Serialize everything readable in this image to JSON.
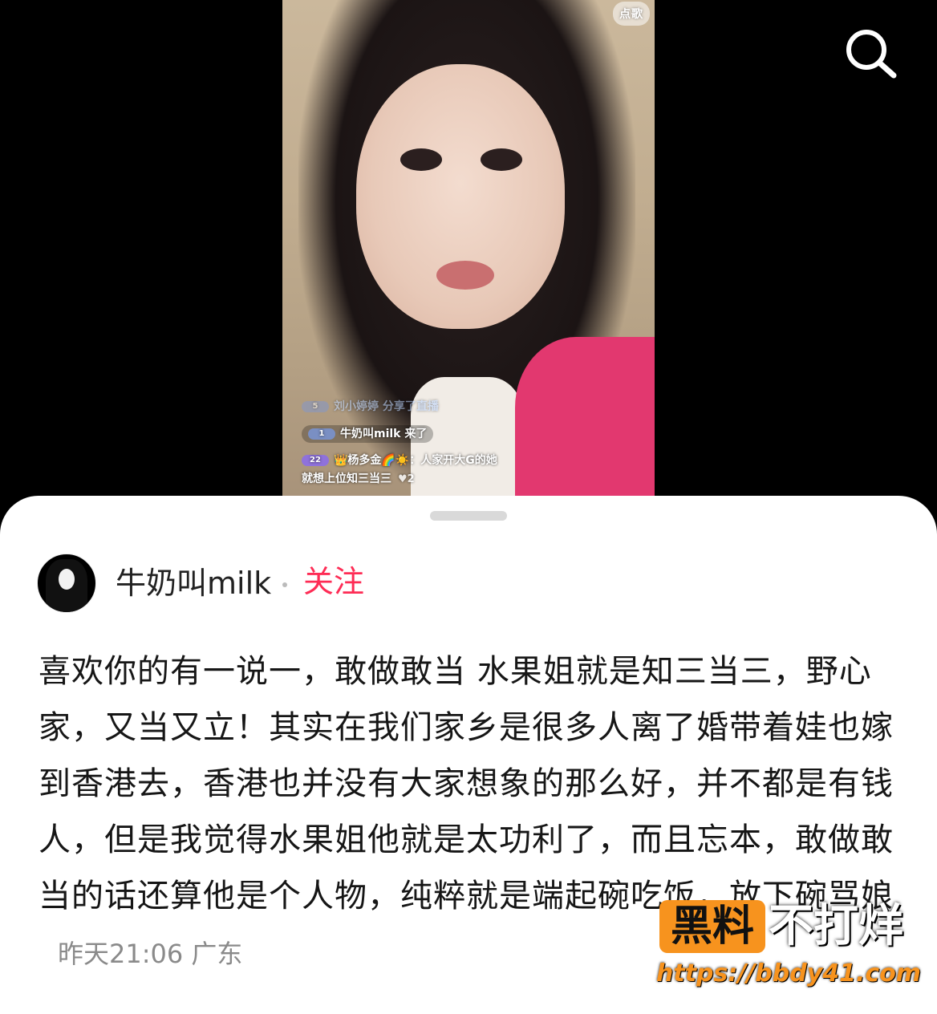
{
  "video": {
    "song_badge": "点歌",
    "chat": [
      {
        "level": "5",
        "text": "刘小婷婷 分享了直播"
      },
      {
        "level": "1",
        "text": "牛奶叫milk 来了"
      },
      {
        "level": "22",
        "user": "👑杨多金🌈☀️：",
        "text": "人家开大G的她"
      },
      {
        "text": "就想上位知三当三",
        "likes": "2"
      }
    ]
  },
  "search": {
    "icon": "search-icon"
  },
  "comment": {
    "username": "牛奶叫milk",
    "follow_label": "关注",
    "body": "喜欢你的有一说一，敢做敢当 水果姐就是知三当三，野心家，又当又立！其实在我们家乡是很多人离了婚带着娃也嫁到香港去，香港也并没有大家想象的那么好，并不都是有钱人，但是我觉得水果姐他就是太功利了，而且忘本，敢做敢当的话还算他是个人物，纯粹就是端起碗吃饭，放下碗骂娘",
    "time": "昨天21:06",
    "location": "广东"
  },
  "watermark": {
    "box_text": "黑料",
    "text": "不打烊",
    "url": "https://bbdy41.com",
    "accent": "#f7931e"
  },
  "colors": {
    "follow": "#fe2c55",
    "background": "#000000",
    "sheet": "#ffffff"
  }
}
